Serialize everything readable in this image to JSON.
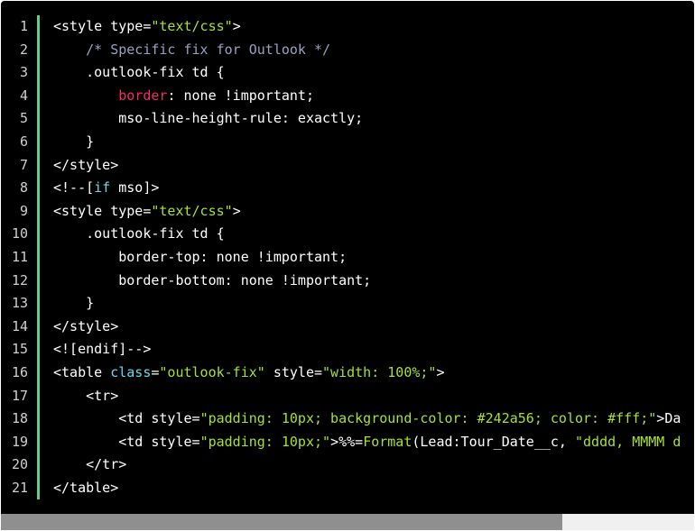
{
  "colors": {
    "background": "#000000",
    "string": "#a6e22e",
    "comment": "#9aa0c0",
    "keyword": "#66d9ef",
    "property": "#f92672",
    "gutter_rule": "#5bd28a"
  },
  "scrollbar": {
    "thumb_fraction": 0.81
  },
  "lines": [
    {
      "n": "1",
      "tokens": [
        [
          "<style type=",
          "plain"
        ],
        [
          "\"text/css\"",
          "string"
        ],
        [
          ">",
          "plain"
        ]
      ]
    },
    {
      "n": "2",
      "tokens": [
        [
          "    ",
          "plain"
        ],
        [
          "/* Specific fix for Outlook */",
          "comment"
        ]
      ]
    },
    {
      "n": "3",
      "tokens": [
        [
          "    .outlook-fix td {",
          "plain"
        ]
      ]
    },
    {
      "n": "4",
      "tokens": [
        [
          "        ",
          "plain"
        ],
        [
          "border",
          "prop"
        ],
        [
          ": none !important;",
          "plain"
        ]
      ]
    },
    {
      "n": "5",
      "tokens": [
        [
          "        mso-line-height-rule: exactly;",
          "plain"
        ]
      ]
    },
    {
      "n": "6",
      "tokens": [
        [
          "    }",
          "plain"
        ]
      ]
    },
    {
      "n": "7",
      "tokens": [
        [
          "</style>",
          "plain"
        ]
      ]
    },
    {
      "n": "8",
      "tokens": [
        [
          "<!--[",
          "plain"
        ],
        [
          "if",
          "keyword"
        ],
        [
          " mso]>",
          "plain"
        ]
      ]
    },
    {
      "n": "9",
      "tokens": [
        [
          "<style type=",
          "plain"
        ],
        [
          "\"text/css\"",
          "string"
        ],
        [
          ">",
          "plain"
        ]
      ]
    },
    {
      "n": "10",
      "tokens": [
        [
          "    .outlook-fix td {",
          "plain"
        ]
      ]
    },
    {
      "n": "11",
      "tokens": [
        [
          "        border-top: none !important;",
          "plain"
        ]
      ]
    },
    {
      "n": "12",
      "tokens": [
        [
          "        border-bottom: none !important;",
          "plain"
        ]
      ]
    },
    {
      "n": "13",
      "tokens": [
        [
          "    }",
          "plain"
        ]
      ]
    },
    {
      "n": "14",
      "tokens": [
        [
          "</style>",
          "plain"
        ]
      ]
    },
    {
      "n": "15",
      "tokens": [
        [
          "<![endif]-->",
          "plain"
        ]
      ]
    },
    {
      "n": "16",
      "tokens": [
        [
          "<table ",
          "plain"
        ],
        [
          "class",
          "keyword"
        ],
        [
          "=",
          "plain"
        ],
        [
          "\"outlook-fix\"",
          "string"
        ],
        [
          " style=",
          "plain"
        ],
        [
          "\"width: 100%;\"",
          "string"
        ],
        [
          ">",
          "plain"
        ]
      ]
    },
    {
      "n": "17",
      "tokens": [
        [
          "    <tr>",
          "plain"
        ]
      ]
    },
    {
      "n": "18",
      "tokens": [
        [
          "        <td style=",
          "plain"
        ],
        [
          "\"padding: 10px; background-color: #242a56; color: #fff;\"",
          "string"
        ],
        [
          ">Da",
          "plain"
        ]
      ]
    },
    {
      "n": "19",
      "tokens": [
        [
          "        <td style=",
          "plain"
        ],
        [
          "\"padding: 10px;\"",
          "string"
        ],
        [
          ">%%=",
          "plain"
        ],
        [
          "Format",
          "string"
        ],
        [
          "(Lead:Tour_Date__c, ",
          "plain"
        ],
        [
          "\"dddd, MMMM d",
          "string"
        ]
      ]
    },
    {
      "n": "20",
      "tokens": [
        [
          "    </tr>",
          "plain"
        ]
      ]
    },
    {
      "n": "21",
      "tokens": [
        [
          "</table>",
          "plain"
        ]
      ]
    }
  ]
}
